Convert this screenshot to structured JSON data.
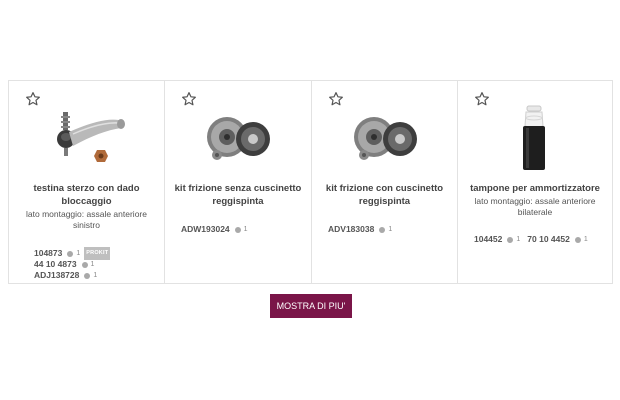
{
  "products": [
    {
      "title": "testina sterzo con dado bloccaggio",
      "description": "lato montaggio: assale anteriore sinistro",
      "image_icon": "tie-rod-end-icon",
      "codes": [
        {
          "code": "104873",
          "count": "1",
          "badge": "PROKIT"
        },
        {
          "code": "44 10 4873",
          "count": "1"
        },
        {
          "code": "ADJ138728",
          "count": "1"
        }
      ]
    },
    {
      "title": "kit frizione senza cuscinetto reggispinta",
      "description": "",
      "image_icon": "clutch-kit-icon",
      "codes": [
        {
          "code": "ADW193024",
          "count": "1"
        }
      ]
    },
    {
      "title": "kit frizione con cuscinetto reggispinta",
      "description": "",
      "image_icon": "clutch-kit-icon",
      "codes": [
        {
          "code": "ADV183038",
          "count": "1"
        }
      ]
    },
    {
      "title": "tampone per ammortizzatore",
      "description": "lato montaggio: assale anteriore bilaterale",
      "image_icon": "bump-stop-icon",
      "codes": [
        {
          "code": "104452",
          "count": "1"
        },
        {
          "code": "70 10 4452",
          "count": "1"
        }
      ]
    }
  ],
  "show_more_label": "MOSTRA DI PIU'",
  "colors": {
    "accent": "#7a1548",
    "border": "#e2e2e2",
    "dot": "#a9a9a9"
  }
}
